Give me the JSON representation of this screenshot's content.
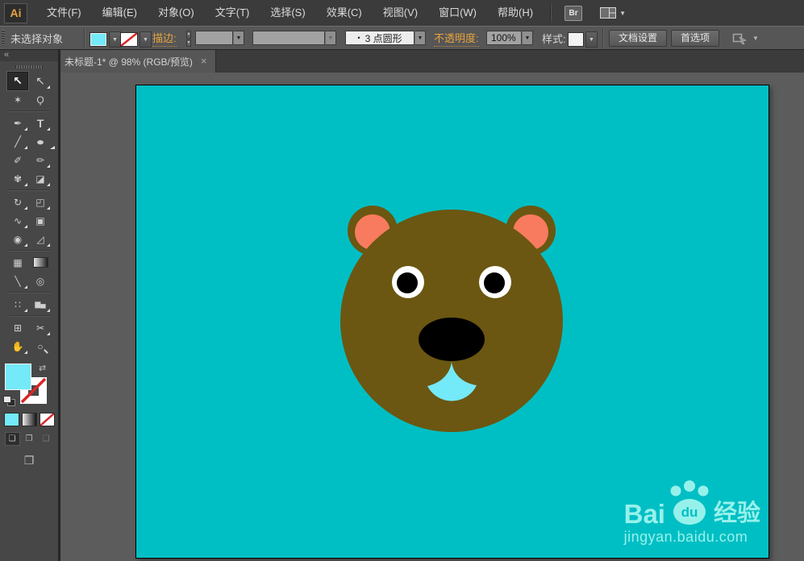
{
  "menu_bar": {
    "logo": "Ai",
    "items": [
      {
        "name": "menu-file",
        "label": "文件(F)"
      },
      {
        "name": "menu-edit",
        "label": "编辑(E)"
      },
      {
        "name": "menu-object",
        "label": "对象(O)"
      },
      {
        "name": "menu-type",
        "label": "文字(T)"
      },
      {
        "name": "menu-select",
        "label": "选择(S)"
      },
      {
        "name": "menu-effect",
        "label": "效果(C)"
      },
      {
        "name": "menu-view",
        "label": "视图(V)"
      },
      {
        "name": "menu-window",
        "label": "窗口(W)"
      },
      {
        "name": "menu-help",
        "label": "帮助(H)"
      }
    ],
    "bridge_label": "Br",
    "workspace_arrow": "▼"
  },
  "control_bar": {
    "status": "未选择对象",
    "fill_color": "#74E9F8",
    "stroke_link": "描边:",
    "brush_dot": "•",
    "brush_value": "3 点圆形",
    "opacity_link": "不透明度:",
    "opacity_value": "100%",
    "style_label": "样式:",
    "document_setup": "文档设置",
    "preferences": "首选项",
    "dd_arrow": "▼",
    "step_up": "▲",
    "step_down": "▼"
  },
  "document_tab": {
    "title": "未标题-1* @ 98% (RGB/预览)",
    "close_glyph": "×"
  },
  "tool_panel": {
    "collapse_glyph": "«",
    "fill_color": "#74E9F8",
    "swap_glyph": "⇄",
    "screen_mode_glyph": "❐",
    "tools": [
      {
        "name": "selection-tool",
        "glyph": "↖",
        "active": true
      },
      {
        "name": "direct-selection-tool",
        "glyph": "↖",
        "fly": true
      },
      {
        "name": "magic-wand-tool",
        "glyph": "✶"
      },
      {
        "name": "lasso-tool",
        "glyph": "Ϙ"
      },
      {
        "sep": true
      },
      {
        "name": "pen-tool",
        "glyph": "✒",
        "fly": true
      },
      {
        "name": "type-tool",
        "glyph": "T",
        "fly": true
      },
      {
        "name": "line-segment-tool",
        "glyph": "╱",
        "fly": true
      },
      {
        "name": "ellipse-tool",
        "glyph": "●",
        "fly": true
      },
      {
        "name": "paintbrush-tool",
        "glyph": "✐"
      },
      {
        "name": "pencil-tool",
        "glyph": "✏",
        "fly": true
      },
      {
        "name": "blob-brush-tool",
        "glyph": "✾",
        "fly": true
      },
      {
        "name": "eraser-tool",
        "glyph": "◪",
        "fly": true
      },
      {
        "sep": true
      },
      {
        "name": "rotate-tool",
        "glyph": "↻",
        "fly": true
      },
      {
        "name": "scale-tool",
        "glyph": "◰",
        "fly": true
      },
      {
        "name": "width-tool",
        "glyph": "∿",
        "fly": true
      },
      {
        "name": "free-transform-tool",
        "glyph": "▣"
      },
      {
        "name": "shape-builder-tool",
        "glyph": "◉",
        "fly": true
      },
      {
        "name": "perspective-grid-tool",
        "glyph": "◿",
        "fly": true
      },
      {
        "sep": true
      },
      {
        "name": "mesh-tool",
        "glyph": "▦"
      },
      {
        "name": "gradient-tool",
        "glyph": ""
      },
      {
        "name": "eyedropper-tool",
        "glyph": "╲",
        "fly": true
      },
      {
        "name": "blend-tool",
        "glyph": "◎"
      },
      {
        "sep": true
      },
      {
        "name": "symbol-sprayer-tool",
        "glyph": "∷",
        "fly": true
      },
      {
        "name": "column-graph-tool",
        "glyph": "▆▄",
        "fly": true
      },
      {
        "sep": true
      },
      {
        "name": "artboard-tool",
        "glyph": "⊞"
      },
      {
        "name": "slice-tool",
        "glyph": "✂",
        "fly": true
      },
      {
        "name": "hand-tool",
        "glyph": "✋",
        "fly": true
      },
      {
        "name": "zoom-tool",
        "glyph": "○"
      }
    ],
    "modes": [
      {
        "name": "draw-normal-mode",
        "glyph": "❏",
        "active": true
      },
      {
        "name": "draw-behind-mode",
        "glyph": "❐"
      },
      {
        "name": "draw-inside-mode",
        "glyph": "❑",
        "dis": true
      }
    ]
  },
  "canvas": {
    "artboard_color": "#00BFC4",
    "bear": {
      "head": "#6B5711",
      "ear_inner": "#F87B5F",
      "eye_white": "#FFFFFF",
      "pupil": "#000000",
      "nose": "#000000",
      "mouth": "#74E9F8"
    }
  },
  "watermark": {
    "bai": "Bai",
    "du": "du",
    "brand": "经验",
    "url": "jingyan.baidu.com",
    "color": "#97F1EB",
    "du_color": "#00BFC4"
  }
}
